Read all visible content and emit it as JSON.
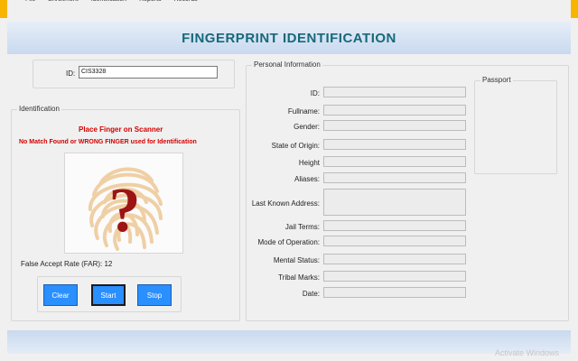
{
  "menu": [
    "File",
    "Enrollment",
    "Identification",
    "Reports",
    "Records"
  ],
  "header": {
    "title": "FINGERPRINT IDENTIFICATION"
  },
  "id_panel": {
    "label": "ID:",
    "value": "CIS3328"
  },
  "identification": {
    "title": "Identification",
    "instruction": "Place Finger on Scanner",
    "status": "No Match Found or WRONG FINGER used for Identification",
    "far_text": "False Accept Rate (FAR): 12",
    "buttons": {
      "clear": "Clear",
      "start": "Start",
      "stop": "Stop"
    },
    "image_icon": "fingerprint-question-icon"
  },
  "personal": {
    "title": "Personal Information",
    "fields": {
      "id": "ID:",
      "fullname": "Fullname:",
      "gender": "Gender:",
      "state": "State of Origin:",
      "height": "Height",
      "aliases": "Aliases:",
      "address": "Last Known Address:",
      "jail": "Jail Terms:",
      "mode": "Mode of Operation:",
      "mental": "Mental Status:",
      "tribal": "Tribal Marks:",
      "date": "Date:"
    }
  },
  "passport": {
    "title": "Passport"
  },
  "watermark": "Activate Windows",
  "colors": {
    "title_text": "#15697a",
    "button": "#2a8fff",
    "alert_text": "#d40000",
    "window_frame": "#f7b500"
  }
}
